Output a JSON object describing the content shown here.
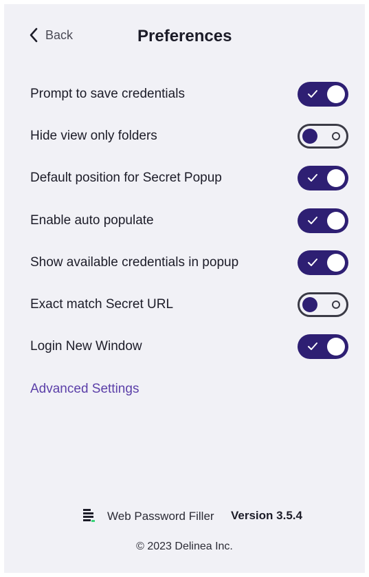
{
  "header": {
    "back_label": "Back",
    "title": "Preferences"
  },
  "preferences": [
    {
      "label": "Prompt to save credentials",
      "enabled": true
    },
    {
      "label": "Hide view only folders",
      "enabled": false
    },
    {
      "label": "Default position for Secret Popup",
      "enabled": true
    },
    {
      "label": "Enable auto populate",
      "enabled": true
    },
    {
      "label": "Show available credentials in popup",
      "enabled": true
    },
    {
      "label": "Exact match Secret URL",
      "enabled": false
    },
    {
      "label": "Login New Window",
      "enabled": true
    }
  ],
  "links": {
    "advanced_settings": "Advanced Settings"
  },
  "footer": {
    "product_name": "Web Password Filler",
    "version": "Version 3.5.4",
    "copyright": "© 2023 Delinea Inc."
  },
  "colors": {
    "accent": "#2e1f73",
    "link": "#5b3fa8",
    "background": "#f1f1f6"
  },
  "icons": {
    "back": "chevron-left-icon",
    "toggle_on": "check-icon",
    "logo": "delinea-logo-icon"
  }
}
